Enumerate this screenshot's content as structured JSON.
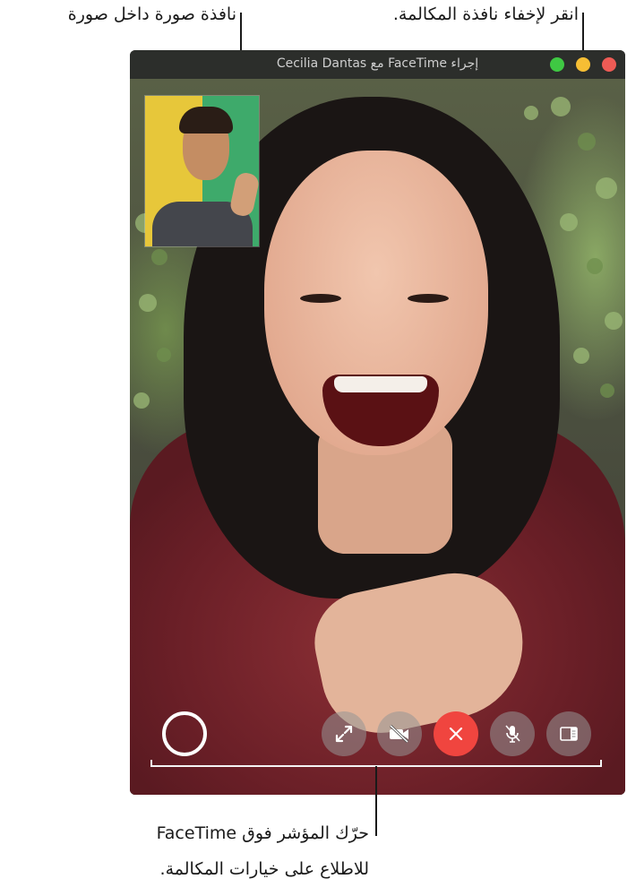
{
  "callouts": {
    "hide_window": "انقر لإخفاء نافذة المكالمة.",
    "pip": "نافذة صورة داخل صورة",
    "hover_line1": "حرّك المؤشر فوق FaceTime",
    "hover_line2": "للاطلاع على خيارات المكالمة."
  },
  "window": {
    "title": "إجراء FaceTime مع Cecilia Dantas",
    "traffic_colors": {
      "close": "#ee5b55",
      "minimize": "#f6be34",
      "zoom": "#3fc843"
    }
  },
  "controls": [
    {
      "name": "take-live-photo-button",
      "icon": "shutter-icon"
    },
    {
      "name": "fullscreen-button",
      "icon": "expand-arrows-icon"
    },
    {
      "name": "camera-off-button",
      "icon": "video-slash-icon"
    },
    {
      "name": "end-call-button",
      "icon": "x-icon",
      "color": "#f0453f"
    },
    {
      "name": "mute-button",
      "icon": "mic-slash-icon"
    },
    {
      "name": "sidebar-button",
      "icon": "sidebar-icon"
    }
  ]
}
